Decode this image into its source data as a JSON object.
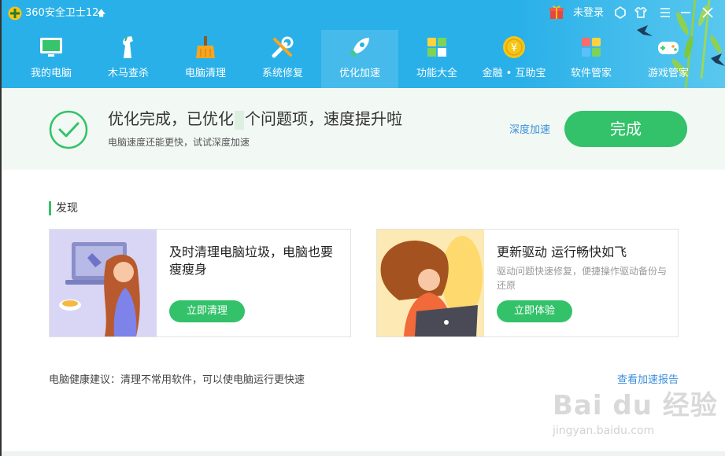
{
  "titlebar": {
    "app_title": "360安全卫士12",
    "up_arrow": "🡅",
    "login_label": "未登录",
    "icons": [
      "gift-icon",
      "skin-icon",
      "shirt-icon",
      "menu-icon",
      "minimize-icon",
      "close-icon"
    ]
  },
  "nav": {
    "items": [
      {
        "label": "我的电脑",
        "icon": "monitor-icon"
      },
      {
        "label": "木马查杀",
        "icon": "trojan-horse-icon"
      },
      {
        "label": "电脑清理",
        "icon": "broom-icon"
      },
      {
        "label": "系统修复",
        "icon": "wrench-icon"
      },
      {
        "label": "优化加速",
        "icon": "rocket-icon",
        "active": true
      },
      {
        "label": "功能大全",
        "icon": "grid-icon"
      },
      {
        "label": "金融 • 互助宝",
        "icon": "coin-icon"
      },
      {
        "label": "软件管家",
        "icon": "apps-icon"
      },
      {
        "label": "游戏管家",
        "icon": "gamepad-icon"
      }
    ]
  },
  "status": {
    "headline_before": "优化完成，已优化",
    "headline_after": "个问题项，速度提升啦",
    "subline": "电脑速度还能更快，试试深度加速",
    "deep_link": "深度加速",
    "done_button": "完成"
  },
  "discover": {
    "title": "发现",
    "cards": [
      {
        "title": "及时清理电脑垃圾，电脑也要瘦瘦身",
        "desc": "",
        "button": "立即清理"
      },
      {
        "title": "更新驱动 运行畅快如飞",
        "desc": "驱动问题快速修复，便捷操作驱动备份与还原",
        "button": "立即体验"
      }
    ]
  },
  "footer": {
    "advice": "电脑健康建议：清理不常用软件，可以使电脑运行更快速",
    "report_link": "查看加速报告"
  },
  "watermark": {
    "brand": "Bai du 经验",
    "url": "jingyan.baidu.com"
  },
  "colors": {
    "header": "#2ab0e8",
    "accent_green": "#33c26a",
    "link_blue": "#3b8fd9",
    "banner_bg": "#f2f9f4"
  }
}
